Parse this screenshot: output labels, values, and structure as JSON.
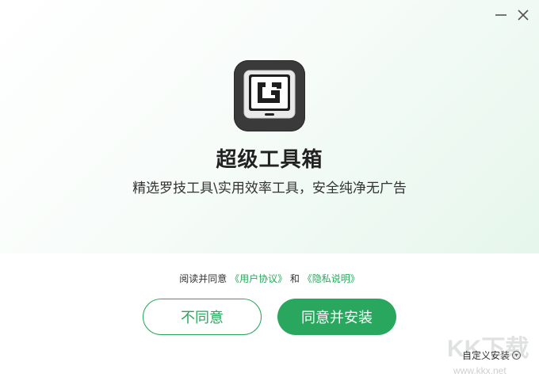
{
  "window": {
    "minimize_icon": "minimize-icon",
    "close_icon": "close-icon"
  },
  "app": {
    "logo_icon": "logitech-g-monitor-logo",
    "title": "超级工具箱",
    "subtitle": "精选罗技工具\\实用效率工具，安全纯净无广告"
  },
  "agreement": {
    "prefix": "阅读并同意",
    "user_agreement": "《用户协议》",
    "conjunction": "和",
    "privacy": "《隐私说明》"
  },
  "buttons": {
    "decline": "不同意",
    "install": "同意并安装"
  },
  "custom_install": {
    "label": "自定义安装",
    "icon": "chevron-down-icon"
  },
  "watermark": {
    "logo_text": "KK下载",
    "url": "www.kkx.net"
  },
  "colors": {
    "accent": "#2aa75e",
    "logo_bg": "#3a3a3a"
  }
}
